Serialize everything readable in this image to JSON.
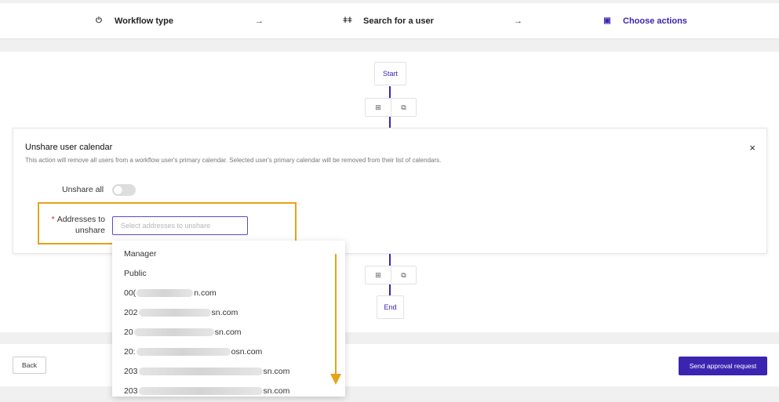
{
  "stepper": {
    "steps": [
      {
        "label": "Workflow type",
        "icon": "power-icon",
        "glyph": "⏻"
      },
      {
        "label": "Search for a user",
        "icon": "people-icon",
        "glyph": "ǂǂ"
      },
      {
        "label": "Choose actions",
        "icon": "clipboard-icon",
        "glyph": "▣"
      }
    ],
    "arrow_glyph": "→",
    "active_color": "#3b25b0"
  },
  "flow": {
    "start_label": "Start",
    "end_label": "End",
    "add_glyph": "⊞",
    "copy_glyph": "⧉"
  },
  "action": {
    "title": "Unshare user calendar",
    "description": "This action will remove all users from a workflow user's primary calendar. Selected user's primary calendar will be removed from their list of calendars.",
    "close_glyph": "×",
    "unshare_all_label": "Unshare all",
    "required_mark": "*",
    "addresses_label": "Addresses to unshare",
    "addresses_placeholder": "Select addresses to unshare"
  },
  "dropdown": {
    "options": [
      {
        "prefix": "Manager",
        "suffix": ""
      },
      {
        "prefix": "Public",
        "suffix": ""
      },
      {
        "prefix": "00(",
        "suffix": "n.com"
      },
      {
        "prefix": "202",
        "suffix": "sn.com"
      },
      {
        "prefix": "20",
        "suffix": "sn.com"
      },
      {
        "prefix": "20:",
        "suffix": "osn.com"
      },
      {
        "prefix": "203",
        "suffix": "sn.com"
      },
      {
        "prefix": "203",
        "suffix": "sn.com"
      }
    ]
  },
  "footer": {
    "back_label": "Back",
    "send_label": "Send approval request"
  },
  "colors": {
    "accent": "#3b25b0",
    "highlight": "#e7a31a"
  }
}
